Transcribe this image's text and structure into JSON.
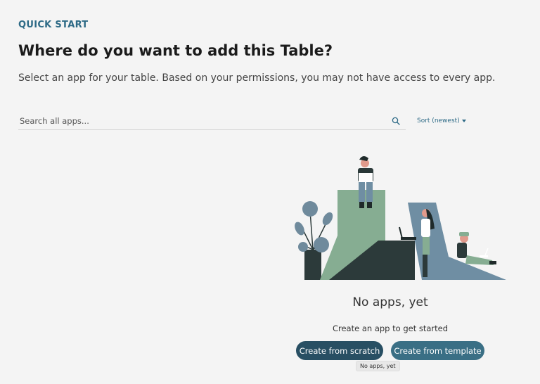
{
  "header": {
    "eyebrow": "QUICK START",
    "title": "Where do you want to add this Table?",
    "subtitle": "Select an app for your table. Based on your permissions, you may not have access to every app."
  },
  "search": {
    "placeholder": "Search all apps...",
    "value": "",
    "icon": "search-icon"
  },
  "sort": {
    "label": "Sort (newest)",
    "icon": "chevron-down-icon"
  },
  "empty_state": {
    "title": "No apps, yet",
    "subtitle": "Create an app to get started",
    "illustration": "people-working-illustration"
  },
  "actions": {
    "create_scratch": "Create from scratch",
    "create_template": "Create from template"
  },
  "tooltip": {
    "text": "No apps, yet"
  },
  "colors": {
    "accent": "#2d6a86",
    "button_dark": "#284f63",
    "button": "#3a6f85",
    "background": "#f4f4f4"
  }
}
